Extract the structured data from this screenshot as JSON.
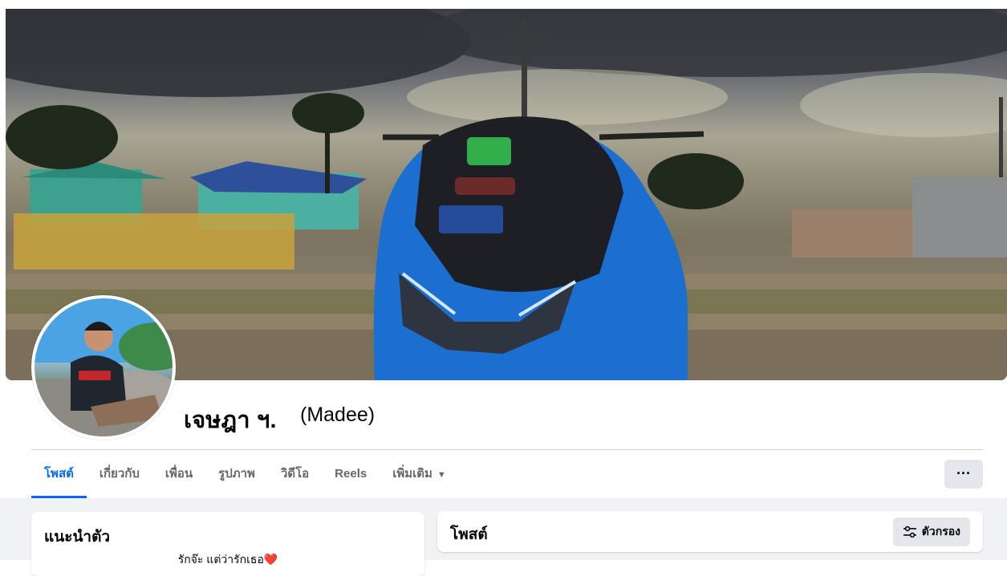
{
  "profile": {
    "name": "เจษฎา ฯ.",
    "alternate_name": "(Madee)"
  },
  "tabs": [
    {
      "label": "โพสต์",
      "active": true
    },
    {
      "label": "เกี่ยวกับ",
      "active": false
    },
    {
      "label": "เพื่อน",
      "active": false
    },
    {
      "label": "รูปภาพ",
      "active": false
    },
    {
      "label": "วิดีโอ",
      "active": false
    },
    {
      "label": "Reels",
      "active": false
    },
    {
      "label": "เพิ่มเติม",
      "active": false
    }
  ],
  "more_button": {
    "label": "···"
  },
  "intro": {
    "title": "แนะนำตัว",
    "bio": "รักจ๊ะ แต่ว่ารักเธอ❤️"
  },
  "posts": {
    "title": "โพสต์",
    "filter_label": "ตัวกรอง"
  },
  "colors": {
    "accent": "#0866ff",
    "background": "#f0f2f5",
    "button_gray": "#e4e6eb"
  },
  "icons": {
    "dropdown": "caret-down-icon",
    "filter": "filter-sliders-icon",
    "more": "more-dots-icon"
  }
}
